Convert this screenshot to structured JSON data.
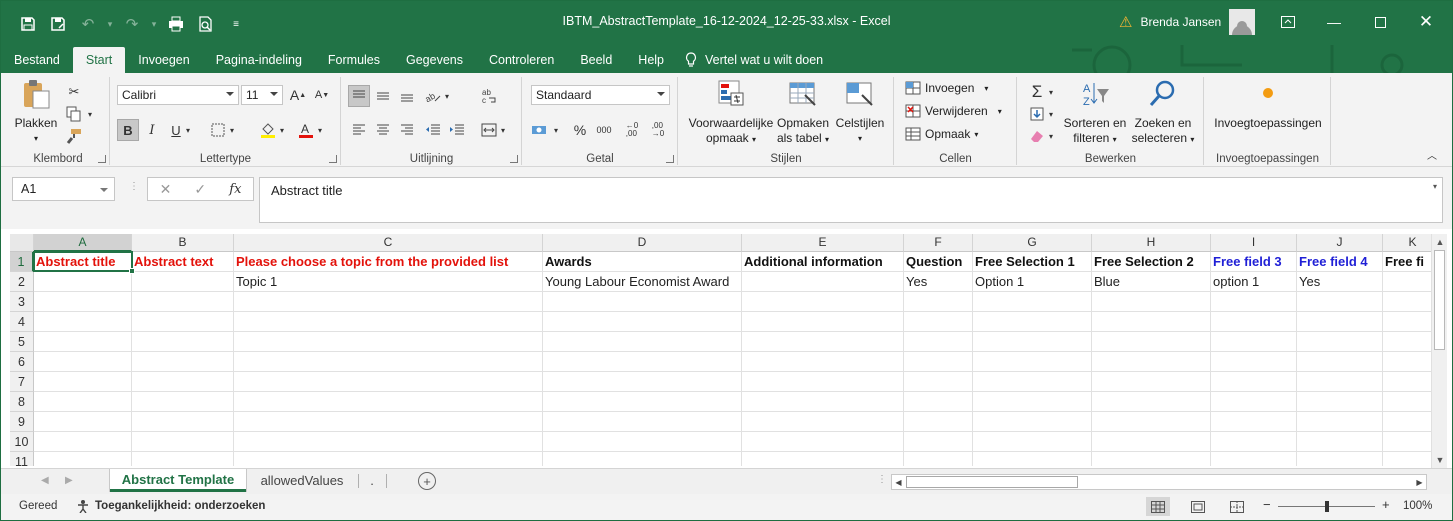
{
  "window": {
    "title": "IBTM_AbstractTemplate_16-12-2024_12-25-33.xlsx  -  Excel",
    "user_name": "Brenda Jansen",
    "colors": {
      "brand": "#217346",
      "header_red": "#e3120b",
      "header_blue": "#1f1fd6",
      "warning": "#f8b634"
    }
  },
  "quick_access": {
    "icons": [
      "save-icon",
      "save-as-icon",
      "undo-icon",
      "redo-icon",
      "print-icon",
      "print-preview-icon",
      "customize-icon"
    ]
  },
  "tabs": {
    "items": [
      "Bestand",
      "Start",
      "Invoegen",
      "Pagina-indeling",
      "Formules",
      "Gegevens",
      "Controleren",
      "Beeld",
      "Help"
    ],
    "active": "Start",
    "tell_me": "Vertel wat u wilt doen"
  },
  "ribbon": {
    "clipboard": {
      "paste": "Plakken",
      "label": "Klembord"
    },
    "font": {
      "name": "Calibri",
      "size": "11",
      "label": "Lettertype",
      "bold": "B",
      "italic": "I",
      "underline": "U"
    },
    "alignment": {
      "label": "Uitlijning"
    },
    "number": {
      "format": "Standaard",
      "label": "Getal",
      "percent": "%",
      "thousands": "000"
    },
    "styles": {
      "conditional_1": "Voorwaardelijke",
      "conditional_2": "opmaak",
      "table_1": "Opmaken",
      "table_2": "als tabel",
      "cell_styles": "Celstijlen",
      "label": "Stijlen"
    },
    "cells": {
      "insert": "Invoegen",
      "delete": "Verwijderen",
      "format": "Opmaak",
      "label": "Cellen"
    },
    "editing": {
      "sort_1": "Sorteren en",
      "sort_2": "filteren",
      "find_1": "Zoeken en",
      "find_2": "selecteren",
      "label": "Bewerken"
    },
    "addins": {
      "button": "Invoegtoepassingen",
      "label": "Invoegtoepassingen"
    }
  },
  "formula_bar": {
    "name_box": "A1",
    "fx": "fx",
    "content": "Abstract title"
  },
  "grid": {
    "columns": [
      "A",
      "B",
      "C",
      "D",
      "E",
      "F",
      "G",
      "H",
      "I",
      "J",
      "K"
    ],
    "rows": [
      "1",
      "2",
      "3",
      "4",
      "5",
      "6",
      "7",
      "8",
      "9",
      "10",
      "11"
    ],
    "header_row": [
      {
        "text": "Abstract title",
        "color": "red"
      },
      {
        "text": "Abstract text",
        "color": "red"
      },
      {
        "text": "Please choose a topic from the provided list",
        "color": "red"
      },
      {
        "text": "Awards",
        "color": "black"
      },
      {
        "text": "Additional information",
        "color": "black"
      },
      {
        "text": "Question",
        "color": "black"
      },
      {
        "text": "Free Selection 1",
        "color": "black"
      },
      {
        "text": "Free Selection 2",
        "color": "black"
      },
      {
        "text": "Free field 3",
        "color": "blue"
      },
      {
        "text": "Free field 4",
        "color": "blue"
      },
      {
        "text": "Free fi",
        "color": "black"
      }
    ],
    "row2": [
      "",
      "",
      "Topic 1",
      "Young Labour Economist Award",
      "",
      "Yes",
      "Option 1",
      "Blue",
      "option 1",
      "Yes",
      ""
    ],
    "selected_cell": "A1"
  },
  "sheets": {
    "tabs": [
      "Abstract Template",
      "allowedValues",
      "."
    ],
    "active": "Abstract Template"
  },
  "status": {
    "ready": "Gereed",
    "accessibility": "Toegankelijkheid: onderzoeken",
    "zoom": "100%",
    "zoom_minus": "−",
    "zoom_plus": "+"
  }
}
